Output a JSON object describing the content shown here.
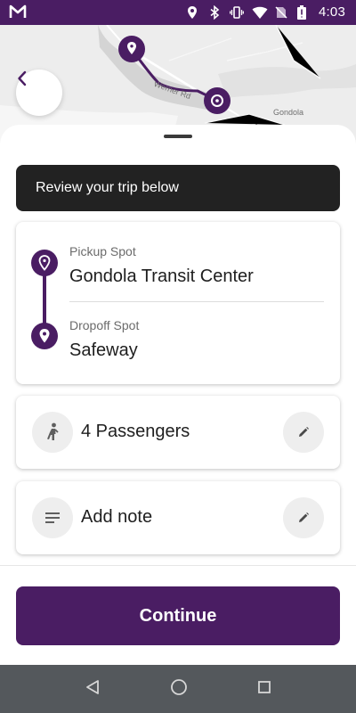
{
  "status_bar": {
    "time": "4:03",
    "icons": [
      "gmail-icon",
      "location-icon",
      "bluetooth-icon",
      "vibrate-icon",
      "wifi-icon",
      "no-sim-icon",
      "battery-icon"
    ]
  },
  "map": {
    "road_label": "Werner Rd",
    "town_label": "Gondola"
  },
  "banner": {
    "text": "Review your trip below"
  },
  "trip": {
    "pickup_label": "Pickup Spot",
    "pickup_value": "Gondola Transit Center",
    "dropoff_label": "Dropoff Spot",
    "dropoff_value": "Safeway"
  },
  "passengers": {
    "text": "4 Passengers"
  },
  "note": {
    "text": "Add note"
  },
  "continue_label": "Continue",
  "colors": {
    "brand": "#4a1d63",
    "banner": "#222222",
    "nav_bar": "#54585c"
  }
}
